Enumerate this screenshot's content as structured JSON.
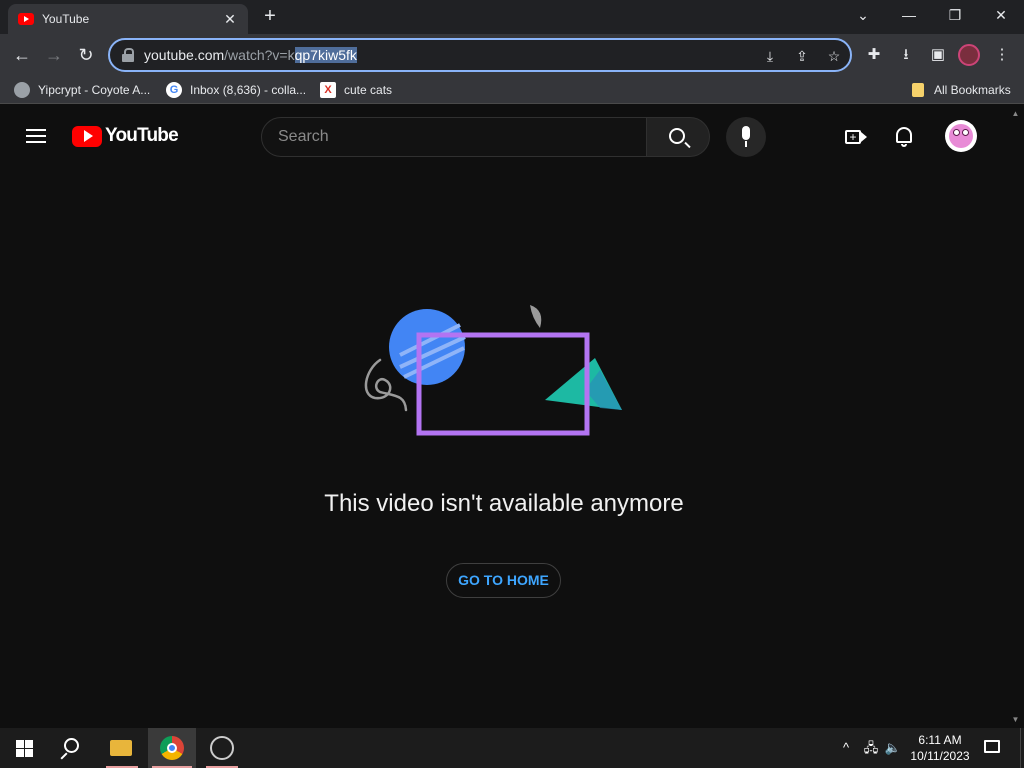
{
  "browser": {
    "tab": {
      "title": "YouTube",
      "close": "✕"
    },
    "new_tab": "+",
    "window_controls": {
      "tabsearch": "⌄",
      "minimize": "—",
      "restore": "❐",
      "close": "✕"
    },
    "url": {
      "host": "youtube.com",
      "path_before_selection": "/watch?v=k",
      "selected": "qp7kiw5fk"
    },
    "bookmarks": [
      {
        "label": "Yipcrypt - Coyote A...",
        "icon": "globe-icon"
      },
      {
        "label": "Inbox (8,636) - colla...",
        "icon": "google-icon",
        "glyph": "G"
      },
      {
        "label": "cute cats",
        "icon": "x-icon",
        "glyph": "X"
      }
    ],
    "all_bookmarks": "All Bookmarks"
  },
  "youtube": {
    "logo_text": "YouTube",
    "search_placeholder": "Search",
    "create_plus": "+",
    "message": "This video isn't available anymore",
    "home_button": "GO TO HOME"
  },
  "taskbar": {
    "time": "6:11 AM",
    "date": "10/11/2023",
    "tray": {
      "chevron": "^",
      "network": "🖧",
      "volume": "🔈"
    }
  },
  "colors": {
    "accent": "#8ab4f8",
    "youtube_red": "#ff0000",
    "link_blue": "#3ea6ff",
    "illustration_purple": "#b374f2",
    "illustration_blue": "#4285f4",
    "illustration_teal": "#1db9a3"
  }
}
